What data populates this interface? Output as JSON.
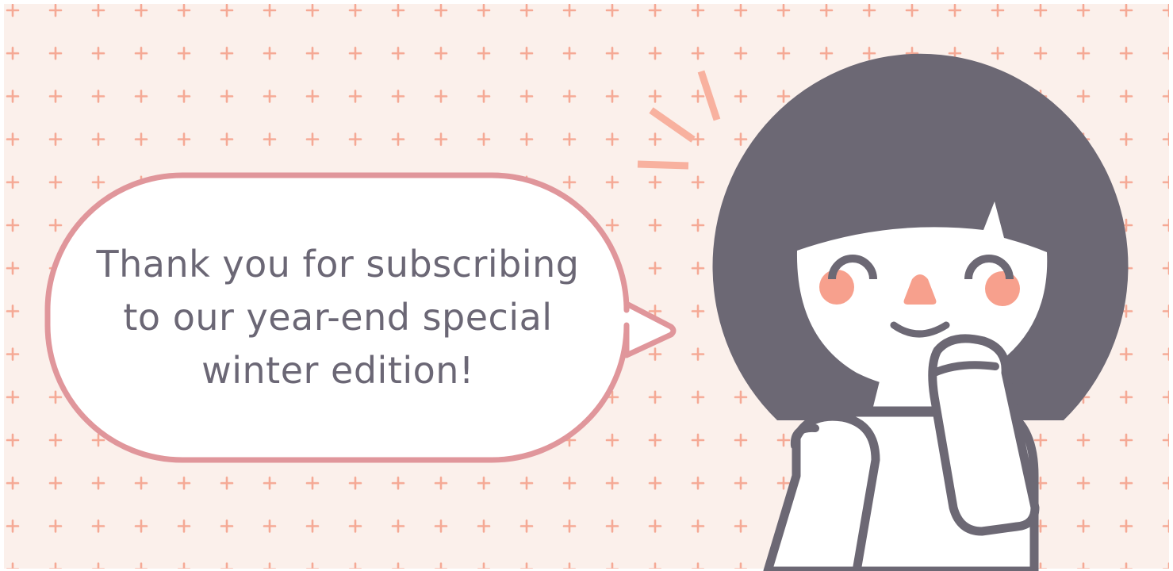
{
  "message": {
    "line1": "Thank you for subscribing",
    "line2": "to our year-end special",
    "line3": "winter edition!"
  },
  "colors": {
    "background": "#fbf0eb",
    "pattern": "#f5a995",
    "bubble_border": "#e0969b",
    "text": "#6b6775",
    "hair": "#6c6874",
    "blush": "#f7a08d",
    "sparkle": "#f8b19f"
  },
  "illustration": {
    "subject": "girl-with-bob-haircut",
    "expression": "smiling-eyes-closed",
    "decoration": "plus-sign-pattern"
  }
}
